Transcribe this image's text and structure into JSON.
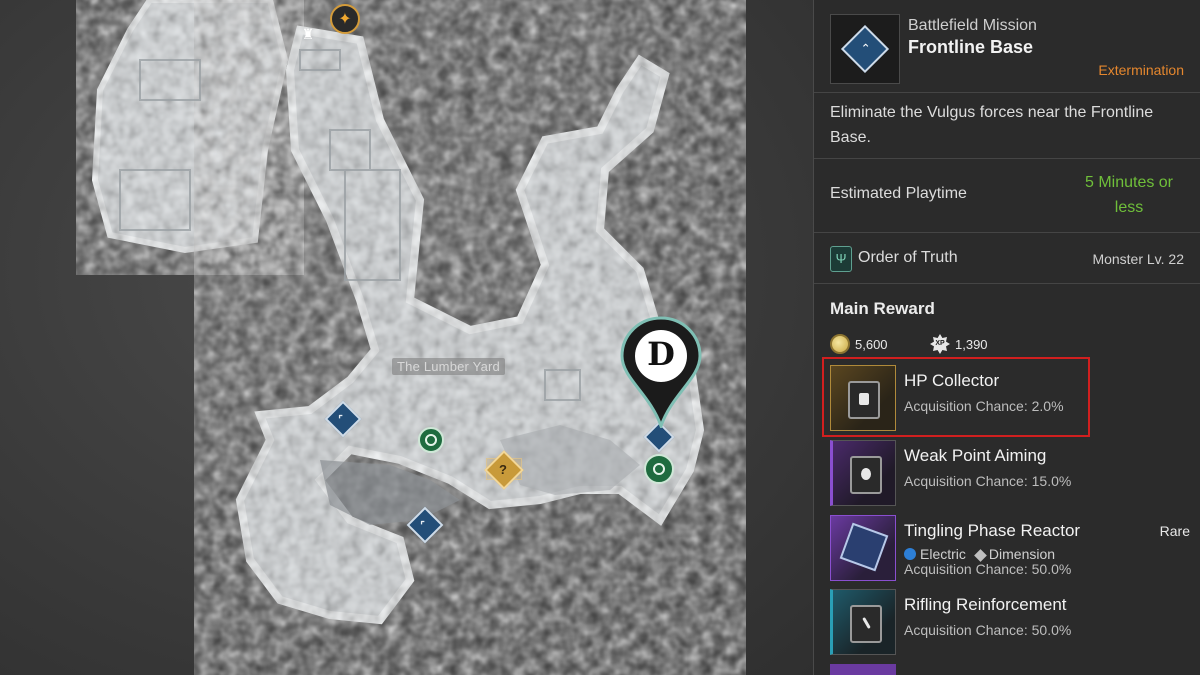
{
  "map": {
    "location_label": "The Lumber Yard",
    "unknown_marker": "?",
    "pin_letter": "D"
  },
  "mission": {
    "type": "Battlefield Mission",
    "name": "Frontline Base",
    "category": "Extermination",
    "description": "Eliminate the Vulgus forces near the Frontline Base.",
    "playtime_label": "Estimated Playtime",
    "playtime_value": "5 Minutes or less",
    "faction": "Order of Truth",
    "monster_level": "Monster Lv. 22"
  },
  "rewards": {
    "heading": "Main Reward",
    "gold": "5,600",
    "xp": "1,390",
    "xp_icon_text": "XP",
    "items": [
      {
        "name": "HP Collector",
        "chance": "Acquisition Chance: 2.0%",
        "rarity": "",
        "color": "#b08a3a"
      },
      {
        "name": "Weak Point Aiming",
        "chance": "Acquisition Chance: 15.0%",
        "rarity": "",
        "color": "#7a3fb0"
      },
      {
        "name": "Tingling Phase Reactor",
        "chance": "Acquisition Chance: 50.0%",
        "rarity": "Rare",
        "tag1": "Electric",
        "tag2": "Dimension",
        "color": "#7a3fb0"
      },
      {
        "name": "Rifling Reinforcement",
        "chance": "Acquisition Chance: 50.0%",
        "rarity": "",
        "color": "#2a8fa6"
      }
    ]
  },
  "icons": {
    "mission": "bookmark-diamond-icon",
    "faction": "trident-icon",
    "gold": "coin-icon",
    "xp": "xp-gear-icon",
    "electric": "lightning-icon",
    "dimension": "diamond-icon"
  }
}
